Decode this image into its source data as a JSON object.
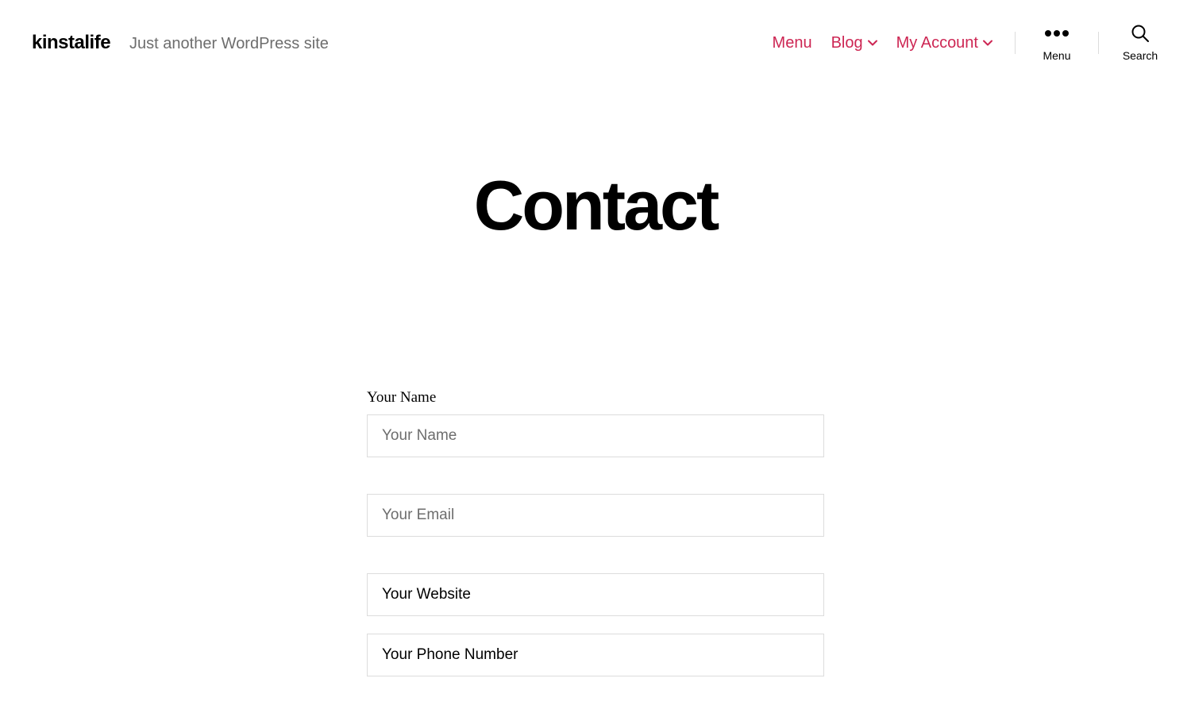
{
  "header": {
    "site_title": "kinstalife",
    "tagline": "Just another WordPress site",
    "nav": [
      {
        "label": "Menu",
        "has_submenu": false
      },
      {
        "label": "Blog",
        "has_submenu": true
      },
      {
        "label": "My Account",
        "has_submenu": true
      }
    ],
    "menu_button_label": "Menu",
    "search_button_label": "Search"
  },
  "page": {
    "title": "Contact"
  },
  "form": {
    "fields": [
      {
        "label": "Your Name",
        "placeholder": "Your Name"
      },
      {
        "placeholder": "Your Email"
      },
      {
        "value": "Your Website"
      },
      {
        "value": "Your Phone Number"
      }
    ]
  },
  "colors": {
    "accent": "#cd2653"
  }
}
